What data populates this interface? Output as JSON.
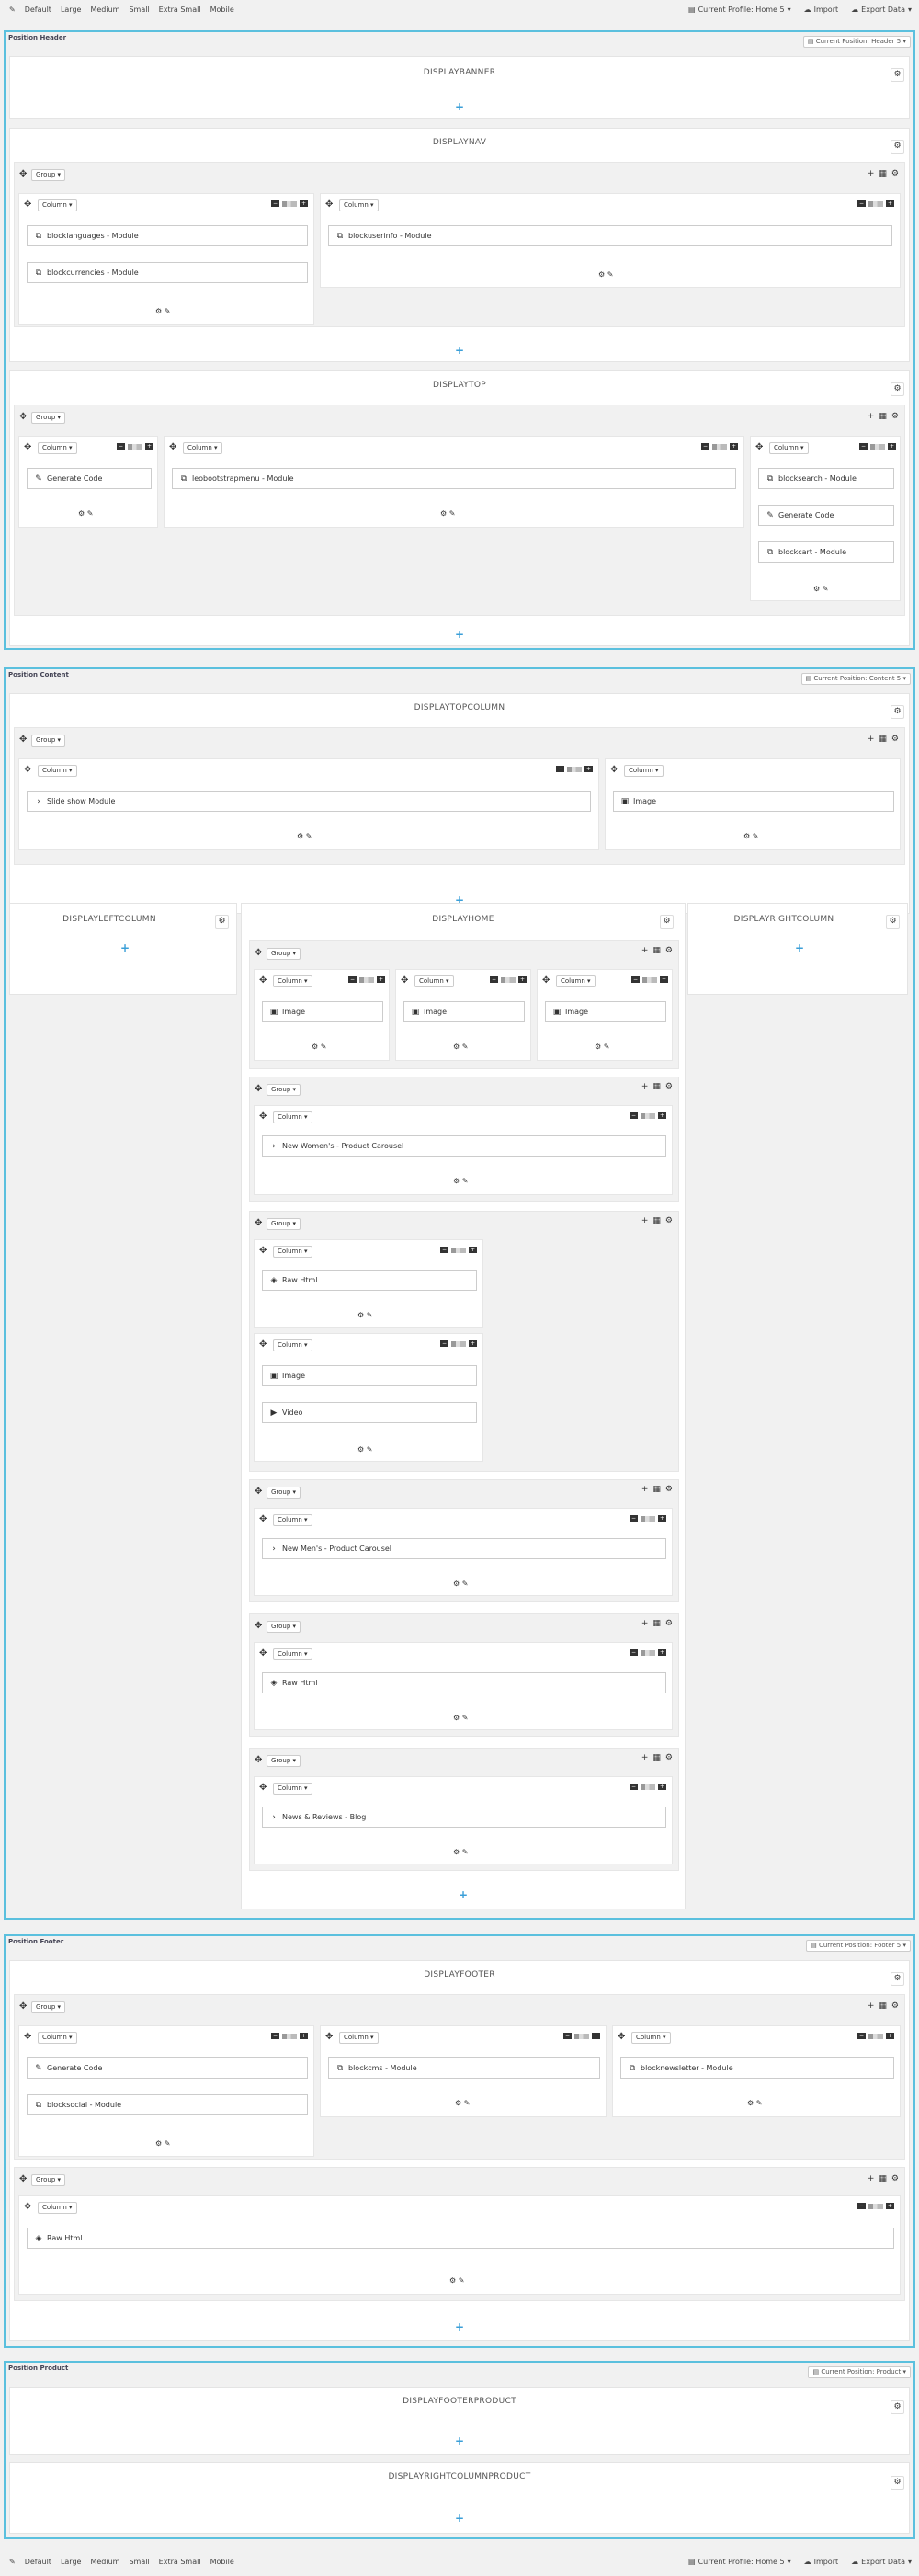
{
  "toolbar": {
    "items": [
      "Default",
      "Large",
      "Medium",
      "Small",
      "Extra Small",
      "Mobile"
    ],
    "profile": "Current Profile: Home 5",
    "import": "Import",
    "export": "Export Data"
  },
  "common": {
    "group": "Group",
    "column": "Column"
  },
  "header": {
    "title": "Position Header",
    "current": "Current Position: Header 5",
    "banner": "DISPLAYBANNER",
    "nav": {
      "title": "DISPLAYNAV",
      "modules": [
        "blocklanguages - Module",
        "blockcurrencies - Module",
        "blockuserinfo - Module"
      ]
    },
    "top": {
      "title": "DISPLAYTOP",
      "modules": [
        "Generate Code",
        "leobootstrapmenu - Module",
        "blocksearch - Module",
        "Generate Code",
        "blockcart - Module"
      ]
    }
  },
  "content": {
    "title": "Position Content",
    "current": "Current Position: Content 5",
    "topcolumn": {
      "title": "DISPLAYTOPCOLUMN",
      "modules": [
        "Slide show Module",
        "Image"
      ]
    },
    "left": "DISPLAYLEFTCOLUMN",
    "right": "DISPLAYRIGHTCOLUMN",
    "home": {
      "title": "DISPLAYHOME",
      "modules": [
        "Image",
        "Image",
        "Image",
        "New Women's - Product Carousel",
        "Raw Html",
        "Image",
        "Video",
        "New Men's - Product Carousel",
        "Raw Html",
        "News & Reviews - Blog"
      ]
    }
  },
  "footer": {
    "title": "Position Footer",
    "current": "Current Position: Footer 5",
    "hook": "DISPLAYFOOTER",
    "modules": [
      "Generate Code",
      "blocksocial - Module",
      "blockcms - Module",
      "blocknewsletter - Module",
      "Raw Html"
    ]
  },
  "product": {
    "title": "Position Product",
    "current": "Current Position: Product",
    "hook1": "DISPLAYFOOTERPRODUCT",
    "hook2": "DISPLAYRIGHTCOLUMNPRODUCT"
  },
  "icons": {
    "gear": "⚙",
    "plus": "+",
    "move": "✥",
    "grid": "▦",
    "edit": "⚙ ✎",
    "caret": "▾",
    "module": "⧉",
    "code": "✎",
    "image": "▣",
    "chevron": "›",
    "html": "◈",
    "video": "▶"
  },
  "colors": {
    "accent": "#3b9fd8",
    "border": "#5bc0de"
  }
}
